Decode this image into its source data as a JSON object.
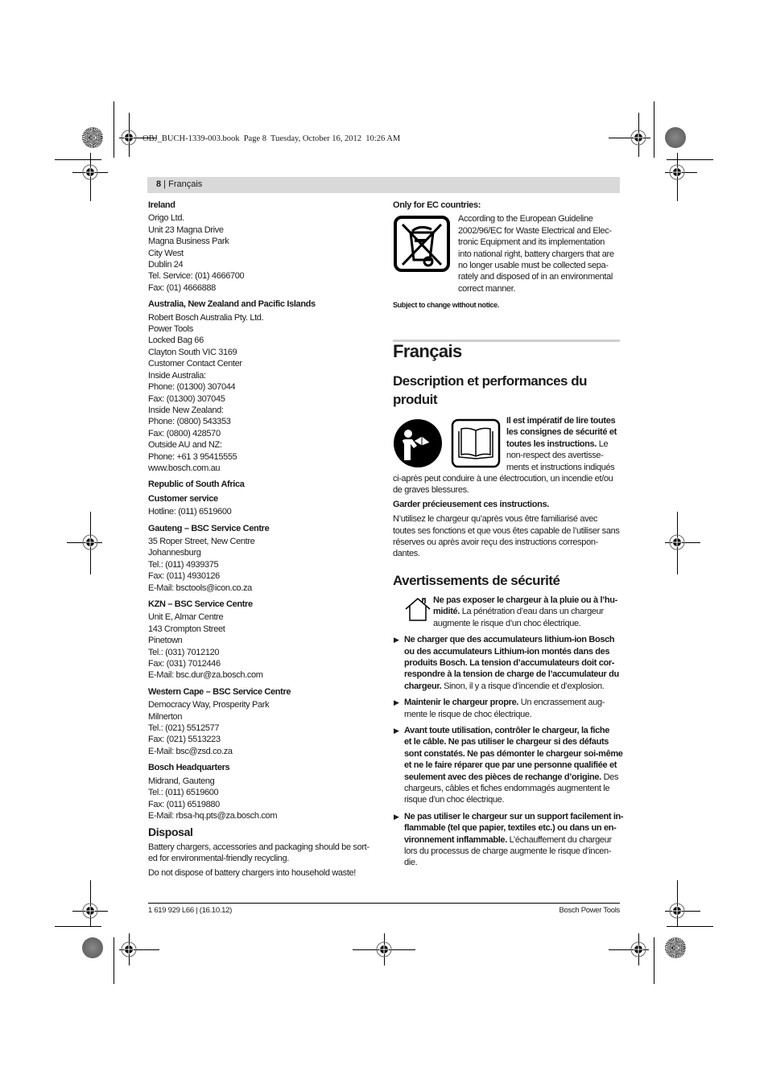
{
  "slug": "OBJ_BUCH-1339-003.book  Page 8  Tuesday, October 16, 2012  10:26 AM",
  "header": {
    "page_number": "8",
    "separator": " | ",
    "section": "Français"
  },
  "left_column": {
    "contacts": [
      {
        "heading": "Ireland",
        "lines": [
          "Origo Ltd.",
          "Unit 23 Magna Drive",
          "Magna Business Park",
          "City West",
          "Dublin 24",
          "Tel. Service: (01) 4666700",
          "Fax: (01) 4666888"
        ]
      },
      {
        "heading": "Australia, New Zealand and Pacific Islands",
        "lines": [
          "Robert Bosch Australia Pty. Ltd.",
          "Power Tools",
          "Locked Bag 66",
          "Clayton South VIC 3169",
          "Customer Contact Center",
          "Inside Australia:",
          "Phone: (01300) 307044",
          "Fax: (01300) 307045",
          "Inside New Zealand:",
          "Phone: (0800) 543353",
          "Fax: (0800) 428570",
          "Outside AU and NZ:",
          "Phone: +61 3 95415555",
          "www.bosch.com.au"
        ]
      },
      {
        "heading": "Republic of South Africa",
        "lines": []
      },
      {
        "heading": "Customer service",
        "lines": [
          "Hotline: (011) 6519600"
        ],
        "tight": true
      },
      {
        "heading": "Gauteng – BSC Service Centre",
        "lines": [
          "35 Roper Street, New Centre",
          "Johannesburg",
          "Tel.: (011) 4939375",
          "Fax: (011) 4930126",
          "E-Mail: bsctools@icon.co.za"
        ]
      },
      {
        "heading": "KZN – BSC Service Centre",
        "lines": [
          "Unit E, Almar Centre",
          "143 Crompton Street",
          "Pinetown",
          "Tel.: (031) 7012120",
          "Fax: (031) 7012446",
          "E-Mail: bsc.dur@za.bosch.com"
        ]
      },
      {
        "heading": "Western Cape – BSC Service Centre",
        "lines": [
          "Democracy Way, Prosperity Park",
          "Milnerton",
          "Tel.: (021) 5512577",
          "Fax: (021) 5513223",
          "E-Mail: bsc@zsd.co.za"
        ]
      },
      {
        "heading": "Bosch Headquarters",
        "lines": [
          "Midrand, Gauteng",
          "Tel.: (011) 6519600",
          "Fax: (011) 6519880",
          "E-Mail: rbsa-hq.pts@za.bosch.com"
        ]
      }
    ],
    "disposal": {
      "heading": "Disposal",
      "paragraph1": "Battery chargers, accessories and packaging should be sort-ed for environmental-friendly recycling.",
      "paragraph1_lines": [
        "Battery chargers, accessories and packaging should be sort-",
        "ed for environmental-friendly recycling."
      ],
      "paragraph2": "Do not dispose of battery chargers into household waste!"
    }
  },
  "right_column": {
    "ec_heading": "Only for EC countries:",
    "ec_icon": "crossed-out-wheelie-bin-icon",
    "ec_text_lines": [
      "According to the European Guideline",
      "2002/96/EC for Waste Electrical and Elec-",
      "tronic Equipment and its implementation",
      "into national right, battery chargers that are",
      "no longer usable must be collected sepa-",
      "rately and disposed of in an environmental",
      "correct manner."
    ],
    "subject_to_change": "Subject to change without notice.",
    "title": "Français",
    "description_heading_lines": [
      "Description et performances du",
      "produit"
    ],
    "read_icons": [
      "person-reading-manual-icon",
      "open-book-icon"
    ],
    "read_bold_lines": [
      "Il est impératif de lire toutes",
      "les consignes de sécurité et",
      "toutes les instructions."
    ],
    "read_after_bold": " Le",
    "read_normal_lines": [
      "non-respect des avertisse-",
      "ments et instructions indiqués"
    ],
    "read_full_lines": [
      "ci-après peut conduire à une électrocution, un incendie et/ou",
      "de graves blessures."
    ],
    "keep_instructions": "Garder précieusement ces instructions.",
    "usage_lines": [
      "N’utilisez le chargeur qu’après vous être familiarisé avec",
      "toutes ses fonctions et que vous êtes capable de l’utiliser sans",
      "réserves ou après avoir reçu des instructions correspon-",
      "dantes."
    ],
    "safety_heading": "Avertissements de sécurité",
    "house_icon": "indoor-use-only-house-icon",
    "rain_bold_lines": [
      "Ne pas exposer le chargeur à la pluie ou à l’hu-",
      "midité."
    ],
    "rain_normal": " La pénétration d’eau dans un chargeur",
    "rain_normal_lines": [
      "augmente le risque d’un choc électrique."
    ],
    "bullets": [
      {
        "bold_lines": [
          "Ne charger que des accumulateurs lithium-ion Bosch",
          "ou des accumulateurs Lithium-ion montés dans des",
          "produits Bosch. La tension d’accumulateurs doit cor-",
          "respondre à la tension de charge de l’accumulateur du",
          "chargeur."
        ],
        "normal_tail": " Sinon, il y a risque d’incendie et d’explosion.",
        "normal_lines": []
      },
      {
        "bold_lines": [
          "Maintenir le chargeur propre."
        ],
        "normal_tail": " Un encrassement aug-",
        "normal_lines": [
          "mente le risque de choc électrique."
        ]
      },
      {
        "bold_lines": [
          "Avant toute utilisation, contrôler le chargeur, la fiche",
          "et le câble. Ne pas utiliser le chargeur si des défauts",
          "sont constatés. Ne pas démonter le chargeur soi-même",
          "et ne le faire réparer que par une personne qualifiée et",
          "seulement avec des pièces de rechange d’origine."
        ],
        "normal_tail": " Des",
        "normal_lines": [
          "chargeurs, câbles et fiches endommagés augmentent le",
          "risque d’un choc électrique."
        ]
      },
      {
        "bold_lines": [
          "Ne pas utiliser le chargeur sur un support facilement in-",
          "flammable (tel que papier, textiles etc.) ou dans un en-",
          "vironnement inflammable."
        ],
        "normal_tail": " L’échauffement du chargeur",
        "normal_lines": [
          "lors du processus de charge augmente le risque d’incen-",
          "die."
        ]
      }
    ]
  },
  "footer": {
    "left": "1 619 929 L66 | (16.10.12)",
    "right": "Bosch Power Tools"
  }
}
